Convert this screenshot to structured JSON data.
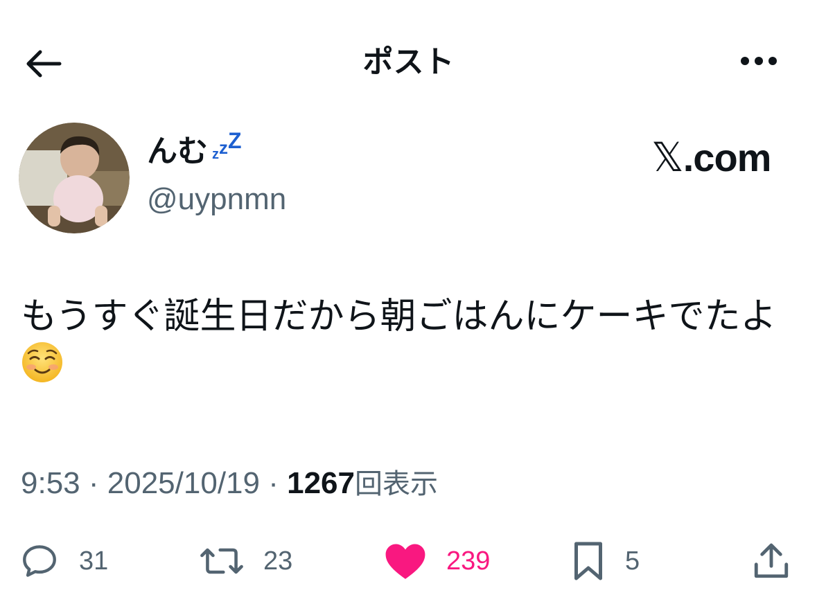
{
  "topbar": {
    "title": "ポスト",
    "back_icon": "arrow-left-icon",
    "more_icon": "more-horizontal-icon"
  },
  "author": {
    "display_name": "んむ",
    "name_emoji": "zzZ",
    "handle": "@uypnmn",
    "avatar_description_icon": "avatar-photo"
  },
  "brand": {
    "x_glyph": "𝕏",
    "domain": ".com"
  },
  "post": {
    "text": "もうすぐ誕生日だから朝ごはんにケーキでたよ",
    "emoji_icon": "smiling-face-icon"
  },
  "meta": {
    "time": "9:53",
    "separator": "·",
    "date": "2025/10/19",
    "views_count": "1267",
    "views_label": "回表示"
  },
  "actions": {
    "replies": "31",
    "reposts": "23",
    "likes": "239",
    "bookmarks": "5"
  },
  "colors": {
    "text": "#0f1419",
    "secondary": "#536471",
    "like": "#f91880",
    "zzz": "#1d5fd0"
  }
}
